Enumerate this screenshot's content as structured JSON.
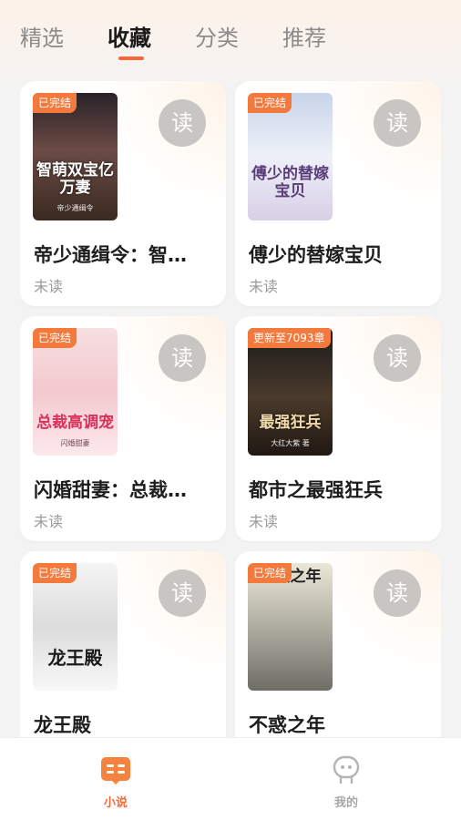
{
  "tabs": [
    {
      "label": "精选",
      "active": false
    },
    {
      "label": "收藏",
      "active": true
    },
    {
      "label": "分类",
      "active": false
    },
    {
      "label": "推荐",
      "active": false
    }
  ],
  "colors": {
    "accent": "#f26a3a",
    "badge": "#f37a3c",
    "read_button": "#c8c5c3"
  },
  "read_label": "读",
  "books": [
    {
      "title": "帝少通缉令：智…",
      "status": "未读",
      "badge": "已完结",
      "cover_text": "智萌双宝亿万妻",
      "cover_author": "帝少通缉令"
    },
    {
      "title": "傅少的替嫁宝贝",
      "status": "未读",
      "badge": "已完结",
      "cover_text": "傅少的替嫁宝贝",
      "cover_author": ""
    },
    {
      "title": "闪婚甜妻：总裁…",
      "status": "未读",
      "badge": "已完结",
      "cover_text": "总裁高调宠",
      "cover_author": "闪婚甜妻"
    },
    {
      "title": "都市之最强狂兵",
      "status": "未读",
      "badge": "更新至7093章",
      "cover_text": "最强狂兵",
      "cover_author": "大红大紫 著"
    },
    {
      "title": "龙王殿",
      "status": "",
      "badge": "已完结",
      "cover_text": "龙王殿",
      "cover_author": ""
    },
    {
      "title": "不惑之年",
      "status": "",
      "badge": "已完结",
      "cover_text": "不惑之年",
      "cover_author": ""
    }
  ],
  "bottom_nav": [
    {
      "label": "小说",
      "icon": "book-icon",
      "active": true
    },
    {
      "label": "我的",
      "icon": "profile-icon",
      "active": false
    }
  ]
}
